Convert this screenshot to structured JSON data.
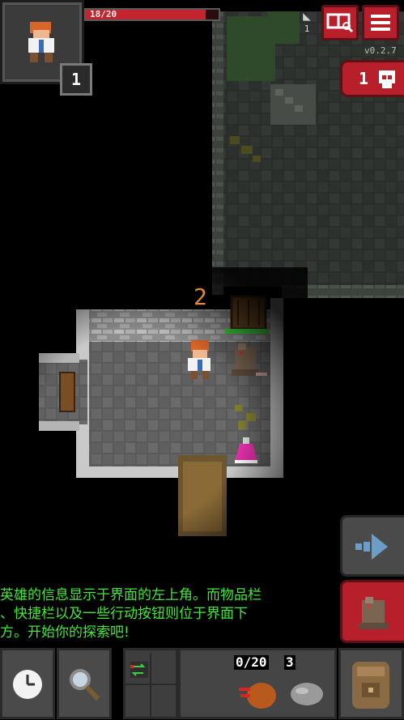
{
  "hud": {
    "hp_text": "18/20",
    "hp_fraction": 0.9,
    "level": "1",
    "depth": "1",
    "version": "v0.2.7",
    "danger_count": "1",
    "floating_number": "2"
  },
  "message": {
    "line1": "英雄的信息显示于界面的左上角。而物品栏",
    "line2": "、快捷栏以及一些行动按钮则位于界面下",
    "line3": "方。开始你的探索吧!"
  },
  "toolbar": {
    "dart_count": "0/20",
    "stone_count": "3"
  },
  "icons": {
    "journal": "journal-icon",
    "menu": "menu-icon",
    "danger": "skull-icon",
    "resume": "resume-arrow-icon",
    "attack": "rat-icon",
    "wait": "clock-icon",
    "search": "magnifier-icon",
    "swap": "swap-icon",
    "backpack": "backpack-icon"
  },
  "colors": {
    "accent_red": "#b71f2a",
    "message_green": "#43e63a",
    "hp_red": "#c2252e"
  }
}
